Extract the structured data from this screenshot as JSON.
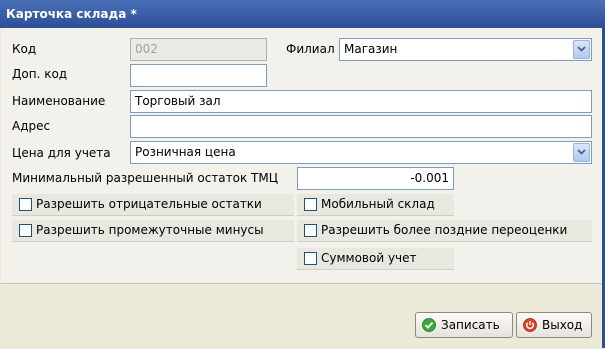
{
  "window": {
    "title": "Карточка склада *"
  },
  "form": {
    "code_label": "Код",
    "code_value": "002",
    "branch_label": "Филиал",
    "branch_value": "Магазин",
    "extra_code_label": "Доп. код",
    "extra_code_value": "",
    "name_label": "Наименование",
    "name_value": "Торговый зал",
    "address_label": "Адрес",
    "address_value": "",
    "price_label": "Цена для учета",
    "price_value": "Розничная цена",
    "min_rest_label": "Минимальный разрешенный остаток ТМЦ",
    "min_rest_value": "-0.001"
  },
  "checkboxes": {
    "negative_rests": {
      "label": "Разрешить отрицательные остатки",
      "checked": false
    },
    "mobile_warehouse": {
      "label": "Мобильный склад",
      "checked": false
    },
    "intermediate_minuses": {
      "label": "Разрешить промежуточные минусы",
      "checked": false
    },
    "later_revaluations": {
      "label": "Разрешить более поздние переоценки",
      "checked": false
    },
    "sum_accounting": {
      "label": "Суммовой учет",
      "checked": false
    }
  },
  "buttons": {
    "save": {
      "label": "Записать",
      "icon": "check-circle-icon",
      "color": "#3aa83a"
    },
    "exit": {
      "label": "Выход",
      "icon": "power-icon",
      "color": "#e04020"
    }
  },
  "colors": {
    "title_bar": "#2c4f96",
    "field_border": "#7f9db9"
  }
}
